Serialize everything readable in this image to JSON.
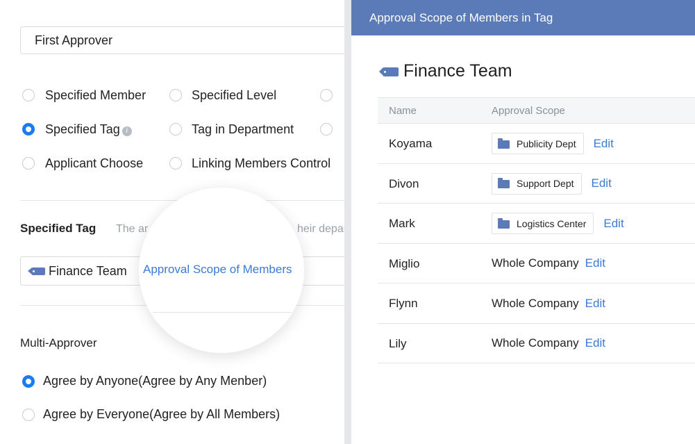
{
  "left_panel": {
    "approver_type_value": "First Approver",
    "approver_options": [
      {
        "label": "Specified Member",
        "checked": false
      },
      {
        "label": "Specified Level",
        "checked": false
      },
      {
        "label": "Specified Tag",
        "checked": true
      },
      {
        "label": "Tag in Department",
        "checked": false
      },
      {
        "label": "Applicant Choose",
        "checked": false
      },
      {
        "label": "Linking Members Control",
        "checked": false
      }
    ],
    "specified_tag_title": "Specified Tag",
    "specified_tag_desc_start": "The ar",
    "specified_tag_desc_end": "heir depar",
    "selected_tag": "Finance Team",
    "approval_scope_link": "Approval Scope of Members",
    "multi_approver_title": "Multi-Approver",
    "multi_options": [
      {
        "label": "Agree by Anyone(Agree by Any Menber)",
        "checked": true
      },
      {
        "label": "Agree by Everyone(Agree by All Members)",
        "checked": false
      }
    ]
  },
  "right_panel": {
    "header_title": "Approval Scope of Members in Tag",
    "tag_name": "Finance Team",
    "columns": {
      "name": "Name",
      "scope": "Approval Scope"
    },
    "edit_label": "Edit",
    "rows": [
      {
        "name": "Koyama",
        "scope": "Publicity Dept",
        "is_dept": true
      },
      {
        "name": "Divon",
        "scope": "Support Dept",
        "is_dept": true
      },
      {
        "name": "Mark",
        "scope": "Logistics Center",
        "is_dept": true
      },
      {
        "name": "Miglio",
        "scope": "Whole Company",
        "is_dept": false
      },
      {
        "name": "Flynn",
        "scope": "Whole Company",
        "is_dept": false
      },
      {
        "name": "Lily",
        "scope": "Whole Company",
        "is_dept": false
      }
    ]
  },
  "colors": {
    "accent_blue": "#1b7cf2",
    "link_blue": "#3a7bd5",
    "header_blue": "#5a7ab8",
    "divider": "#e6e7ea"
  }
}
